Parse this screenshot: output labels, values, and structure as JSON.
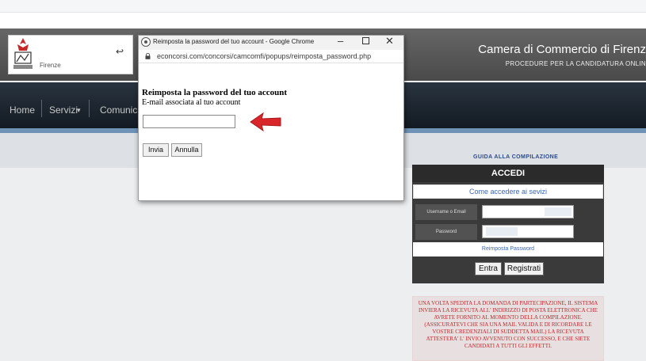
{
  "popup": {
    "window_title": "Reimposta la password del tuo account - Google Chrome",
    "url": "econcorsi.com/concorsi/camcomfi/popups/reimposta_password.php",
    "form_title": "Reimposta la password del tuo account",
    "email_label": "E-mail associata al tuo account",
    "email_value": "",
    "send_label": "Invia",
    "cancel_label": "Annulla",
    "minimize_glyph": "–",
    "close_glyph": "✕"
  },
  "header": {
    "title": "Camera di Commercio di Firenz",
    "subtitle": "PROCEDURE PER LA CANDIDATURA ONLIN",
    "logo_text": "Firenze"
  },
  "nav": {
    "items": [
      "Home",
      "Servizi",
      "Comunicaz"
    ],
    "dropdown_glyph": "▾"
  },
  "login": {
    "guide_link": "GUIDA ALLA COMPILAZIONE",
    "heading": "ACCEDI",
    "help_link": "Come accedere ai sevizi",
    "username_label": "Username o Email",
    "password_label": "Password",
    "reset_link": "Reimposta Password",
    "enter_label": "Entra",
    "register_label": "Registrati"
  },
  "notice": {
    "text": "UNA VOLTA SPEDITA LA DOMANDA DI PARTECIPAZIONE, IL SISTEMA INVIERA LA RICEVUTA ALL' INDIRIZZO DI POSTA ELETTRONICA CHE AVRETE FORNITO AL MOMENTO DELLA COMPILAZIONE. (ASSICURATEVI CHE SIA UNA MAIL VALIDA E DI RICORDARE LE VOSTRE CREDENZIALI DI SUDDETTA MAIL) LA RICEVUTA ATTESTERA' L' INVIO AVVENUTO CON SUCCESSO, E CHE SIETE CANDIDATI A TUTTI GLI EFFETTI."
  },
  "colors": {
    "arrow": "#d9262b",
    "navbar": "#1a2129",
    "link": "#3f67b5",
    "notice_text": "#c0272d"
  },
  "icons": [
    "chrome-icon",
    "lock-icon",
    "arrow-icon",
    "logo-emblem"
  ]
}
